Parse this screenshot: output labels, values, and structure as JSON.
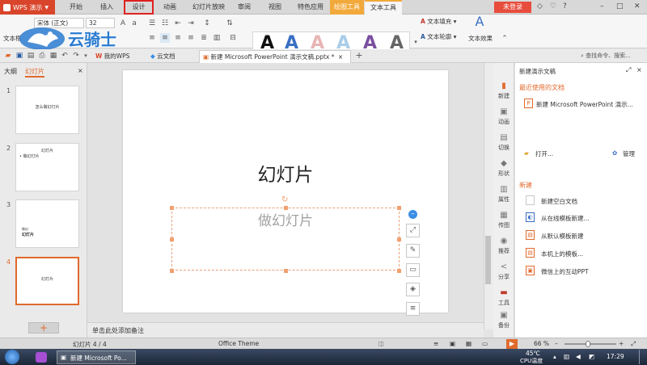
{
  "colors": {
    "brand": "#d9452b",
    "accent": "#e06a2c",
    "context_tab": "#f2a93b",
    "highlight_box": "#e02020"
  },
  "menubar": {
    "app_label": "WPS 演示",
    "tabs": [
      "开始",
      "插入",
      "设计",
      "动画",
      "幻灯片放映",
      "审阅",
      "视图",
      "特色应用",
      "绘图工具",
      "文本工具"
    ],
    "login": "未登录",
    "window_controls": [
      "◇",
      "♡",
      "?",
      "–",
      "□",
      "✕"
    ]
  },
  "ribbon": {
    "text_box_label": "文本框",
    "font_name": "宋体 (正文)",
    "font_size": "32",
    "text_fill": "文本填充",
    "text_outline": "文本轮廓",
    "text_effect": "文本效果",
    "wordart_letters": [
      "A",
      "A",
      "A",
      "A",
      "A",
      "A"
    ],
    "wordart_colors": [
      "#111111",
      "#3a6fc4",
      "#e8b4b4",
      "#a9cde8",
      "#7a4fa0",
      "#666666"
    ]
  },
  "watermark": {
    "text": "云骑士"
  },
  "qbar": {
    "tabs": [
      {
        "label": "我的WPS",
        "icon": "wps-icon"
      },
      {
        "label": "云文档",
        "icon": "cloud-icon"
      },
      {
        "label": "新建 Microsoft PowerPoint 演示文稿.pptx *",
        "icon": "ppt-icon"
      }
    ],
    "add_tab": "+",
    "search": "查找命令、搜索..."
  },
  "left_panel": {
    "tabs": [
      "大纲",
      "幻灯片"
    ],
    "close": "×",
    "slides": [
      {
        "num": "1",
        "lines": [
          "怎么做幻灯片"
        ]
      },
      {
        "num": "2",
        "lines": [
          "幻灯片",
          "• 做幻灯片"
        ]
      },
      {
        "num": "3",
        "lines": [
          "做幻",
          "幻灯片"
        ]
      },
      {
        "num": "4",
        "lines": [
          "幻灯片"
        ]
      }
    ],
    "add": "+"
  },
  "slide": {
    "title": "幻灯片",
    "body": "做幻灯片"
  },
  "float_tools": [
    "–",
    "⤢",
    "✎",
    "▭",
    "◈",
    "≡"
  ],
  "notes": "单击此处添加备注",
  "side_strip": [
    {
      "label": "新建",
      "icon": "new-doc-icon",
      "glyph": "▮"
    },
    {
      "label": "动画",
      "icon": "animation-icon",
      "glyph": "▣"
    },
    {
      "label": "切换",
      "icon": "transition-icon",
      "glyph": "▤"
    },
    {
      "label": "形状",
      "icon": "shape-icon",
      "glyph": "◆"
    },
    {
      "label": "属性",
      "icon": "properties-icon",
      "glyph": "▥"
    },
    {
      "label": "传图",
      "icon": "upload-image-icon",
      "glyph": "▦"
    },
    {
      "label": "推荐",
      "icon": "recommend-icon",
      "glyph": "◉"
    },
    {
      "label": "分享",
      "icon": "share-icon",
      "glyph": "<"
    },
    {
      "label": "工具",
      "icon": "tools-icon",
      "glyph": "▬"
    },
    {
      "label": "备份",
      "icon": "backup-icon",
      "glyph": "▣"
    }
  ],
  "task_pane": {
    "title": "新建演示文稿",
    "recent_heading": "最近使用的文档",
    "recent_file": "新建 Microsoft PowerPoint 演示...",
    "open": "打开...",
    "manage": "管理",
    "new_heading": "新建",
    "new_items": [
      "新建空白文档",
      "从在线模板新建...",
      "从默认模板新建",
      "本机上的模板...",
      "微信上的互动PPT"
    ]
  },
  "status": {
    "slide_count": "幻灯片 4 / 4",
    "theme": "Office Theme",
    "zoom": "66 %",
    "zoom_fraction": 0.45
  },
  "taskbar": {
    "app": "新建 Microsoft Po...",
    "temp": "45℃",
    "cpu": "CPU温度",
    "time": "17:29"
  }
}
